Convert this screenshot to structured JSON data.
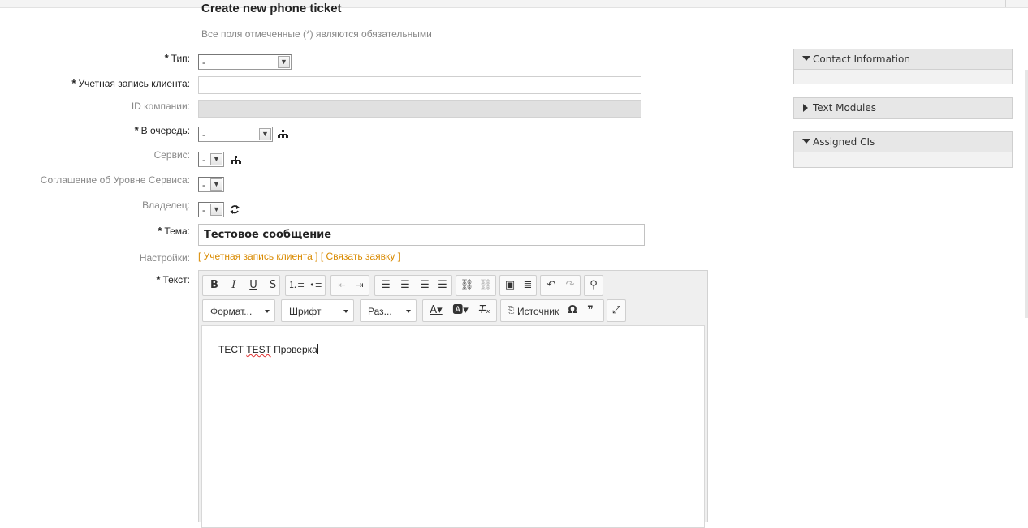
{
  "page": {
    "title": "Create new phone ticket",
    "required_hint": "Все поля отмеченные (*) являются обязательными"
  },
  "form": {
    "type": {
      "label": "Тип:",
      "value": "-"
    },
    "customer_user": {
      "label": "Учетная запись клиента:",
      "value": ""
    },
    "company_id": {
      "label": "ID компании:",
      "value": ""
    },
    "queue": {
      "label": "В очередь:",
      "value": "-"
    },
    "service": {
      "label": "Сервис:",
      "value": "-"
    },
    "sla": {
      "label": "Соглашение об Уровне Сервиса:",
      "value": "-"
    },
    "owner": {
      "label": "Владелец:",
      "value": "-"
    },
    "subject": {
      "label": "Тема:",
      "value": "Тестовое сообщение"
    },
    "options": {
      "label": "Настройки:",
      "link_customer": "[ Учетная запись клиента ]",
      "link_ticket": "[ Связать заявку ]"
    },
    "text": {
      "label": "Текст:"
    },
    "required_star": "*"
  },
  "editor": {
    "format_label": "Формат...",
    "font_label": "Шрифт",
    "size_label": "Раз...",
    "source_label": "Источник",
    "content_words": [
      "ТЕСТ",
      "TEST",
      "Проверка"
    ]
  },
  "sidebar": {
    "widgets": [
      {
        "title": "Contact Information",
        "expanded": true
      },
      {
        "title": "Text Modules",
        "expanded": false
      },
      {
        "title": "Assigned CIs",
        "expanded": true
      }
    ]
  },
  "icons": {
    "tree": "sitemap-icon",
    "refresh": "refresh-icon"
  },
  "colors": {
    "link": "#d98a00",
    "muted_label": "#888888",
    "spell_error": "#e03030"
  }
}
